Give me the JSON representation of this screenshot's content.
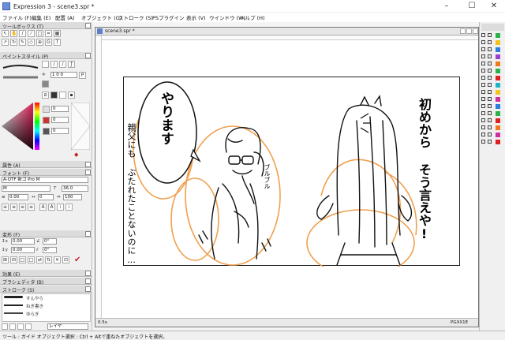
{
  "window": {
    "title": "Expression 3 - scene3.spr *",
    "controls": [
      "–",
      "☐",
      "✕"
    ]
  },
  "menu": [
    "ファイル (F)",
    "編集 (E)",
    "配置 (A)",
    "オブジェクト (O)",
    "ストローク (S)",
    "PSプラグイン",
    "表示 (V)",
    "ウインドウ (W)",
    "ヘルプ (H)"
  ],
  "panels": {
    "toolbox": "ツールボックス (T)",
    "paintstyle": "ペイントスタイル (P)",
    "attributes": "属性 (A)",
    "font": "フォント (F)",
    "transform": "変形 (F)",
    "effects": "効果 (E)",
    "brushpath": "ブラシェディタ (B)",
    "stroke": "ストローク (S)"
  },
  "paintstyle_values": [
    "1 0 0",
    "0",
    "0",
    "0"
  ],
  "font": {
    "name": "A-OTF 新ゴ Pro M",
    "style": "M",
    "size": "36.0",
    "leading": "0.00",
    "tracking": "0",
    "scale": "100"
  },
  "transform": {
    "x": "0.00",
    "y": "0.00",
    "angle": "0°",
    "skew": "0°"
  },
  "stroke_items": [
    "すんやら",
    "ねぎ書き",
    "ゆらぎ"
  ],
  "layer_field": "レイヤ",
  "document": {
    "tab_title": "scene3.spr *",
    "zoom": "0.5x",
    "coord": "PGXX1E"
  },
  "manga": {
    "bubble_text": "やります",
    "narration_left": "親父にも ぶたれたことないのに…",
    "sfx": "ブルブル",
    "right_dialogue": "初めから そう言えや!"
  },
  "colors": {
    "accent_orange": "#f0a050",
    "title_bar": "#ffffff",
    "panel_bg": "#f0f0f0"
  },
  "status": "ツール : ガイド オブジェクト選択 : Ctrl + Altで重ねたオブジェクトを選択。"
}
